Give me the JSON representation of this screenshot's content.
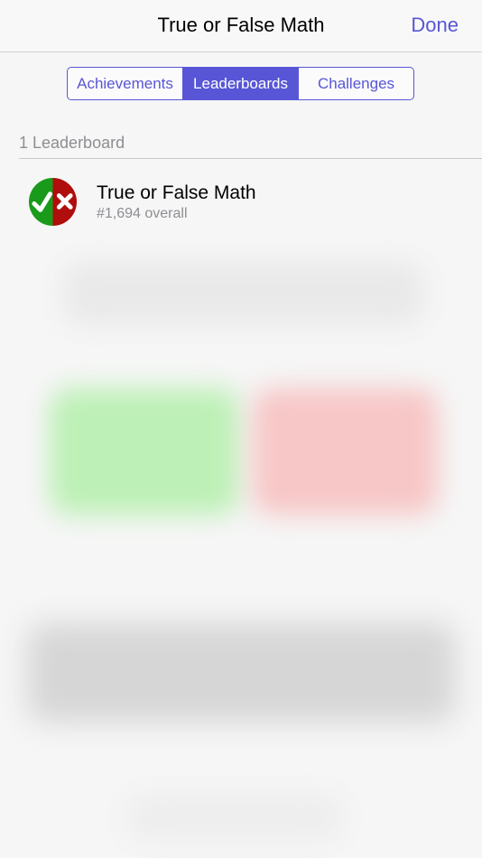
{
  "nav": {
    "title": "True or False Math",
    "done_label": "Done"
  },
  "tabs": [
    {
      "label": "Achievements",
      "selected": false
    },
    {
      "label": "Leaderboards",
      "selected": true
    },
    {
      "label": "Challenges",
      "selected": false
    }
  ],
  "section": {
    "header": "1 Leaderboard"
  },
  "leaderboards": [
    {
      "name": "True or False Math",
      "rank": "#1,694 overall",
      "icon": "check-cross-icon"
    }
  ],
  "colors": {
    "accent": "#5856d6",
    "icon_green": "#1a9a1a",
    "icon_red": "#b00d0d",
    "secondary_text": "#8e8e93"
  }
}
